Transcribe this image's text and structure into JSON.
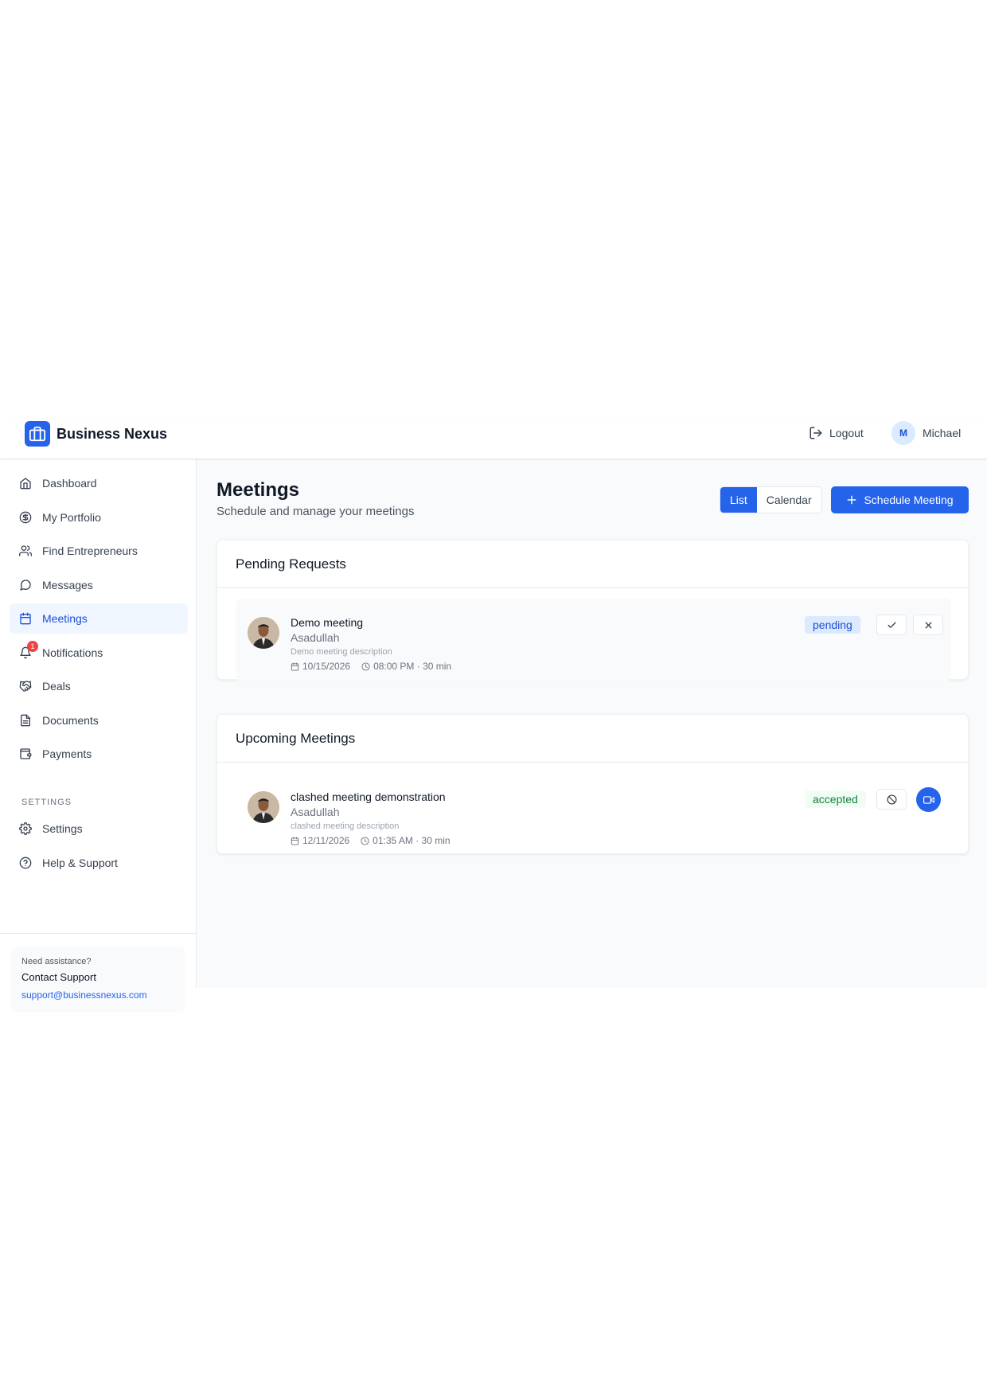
{
  "header": {
    "brand_name": "Business Nexus",
    "logout_label": "Logout",
    "user_initial": "M",
    "user_name": "Michael"
  },
  "sidebar": {
    "items": [
      {
        "label": "Dashboard",
        "icon": "home-icon"
      },
      {
        "label": "My Portfolio",
        "icon": "dollar-circle-icon"
      },
      {
        "label": "Find Entrepreneurs",
        "icon": "users-icon"
      },
      {
        "label": "Messages",
        "icon": "message-circle-icon"
      },
      {
        "label": "Meetings",
        "icon": "calendar-icon",
        "active": true
      },
      {
        "label": "Notifications",
        "icon": "bell-icon",
        "badge": "1"
      },
      {
        "label": "Deals",
        "icon": "handshake-icon"
      },
      {
        "label": "Documents",
        "icon": "file-text-icon"
      },
      {
        "label": "Payments",
        "icon": "wallet-icon"
      }
    ],
    "settings_heading": "SETTINGS",
    "settings_items": [
      {
        "label": "Settings",
        "icon": "gear-icon"
      },
      {
        "label": "Help & Support",
        "icon": "help-circle-icon"
      }
    ],
    "support": {
      "small": "Need assistance?",
      "title": "Contact Support",
      "email": "support@businessnexus.com"
    }
  },
  "main": {
    "title": "Meetings",
    "subtitle": "Schedule and manage your meetings",
    "view_toggle": {
      "list": "List",
      "calendar": "Calendar",
      "selected": "List"
    },
    "schedule_button": "Schedule Meeting",
    "pending": {
      "heading": "Pending Requests",
      "meetings": [
        {
          "title": "Demo meeting",
          "with": "Asadullah",
          "description": "Demo meeting description",
          "date": "10/15/2026",
          "time": "08:00 PM · 30 min",
          "status": "pending"
        }
      ]
    },
    "upcoming": {
      "heading": "Upcoming Meetings",
      "meetings": [
        {
          "title": "clashed meeting demonstration",
          "with": "Asadullah",
          "description": "clashed meeting description",
          "date": "12/11/2026",
          "time": "01:35 AM · 30 min",
          "status": "accepted"
        }
      ]
    }
  },
  "colors": {
    "primary": "#2563eb",
    "pending_bg": "#dbeafe",
    "accepted_text": "#15803d",
    "badge_red": "#ef4444"
  }
}
